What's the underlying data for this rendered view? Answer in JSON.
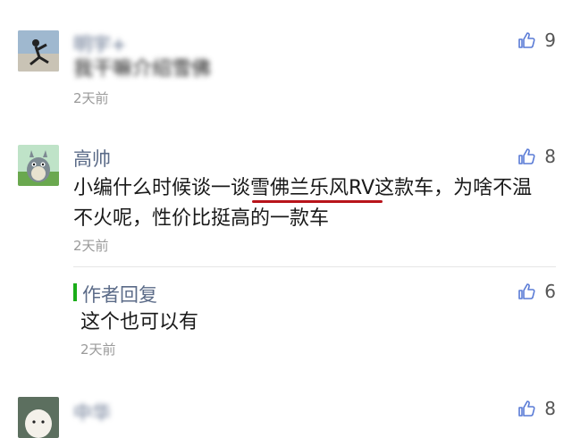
{
  "comments": [
    {
      "name": "明宇+",
      "text": "我干嘛介绍雪佛",
      "time": "2天前",
      "likes": "9"
    },
    {
      "name": "高帅",
      "text_line1": "小编什么时候谈一谈雪佛兰乐风RV这款车，为啥不温",
      "text_line2": "不火呢，性价比挺高的一款车",
      "time": "2天前",
      "likes": "8"
    },
    {
      "reply_label": "作者回复",
      "text": "这个也可以有",
      "time": "2天前",
      "likes": "6"
    },
    {
      "name": "中华",
      "likes": "8"
    }
  ],
  "colors": {
    "name": "#5b6b88",
    "accent_green": "#1aad19",
    "underline_red": "#b8141b"
  },
  "icons": {
    "like": "thumbs-up-icon"
  }
}
